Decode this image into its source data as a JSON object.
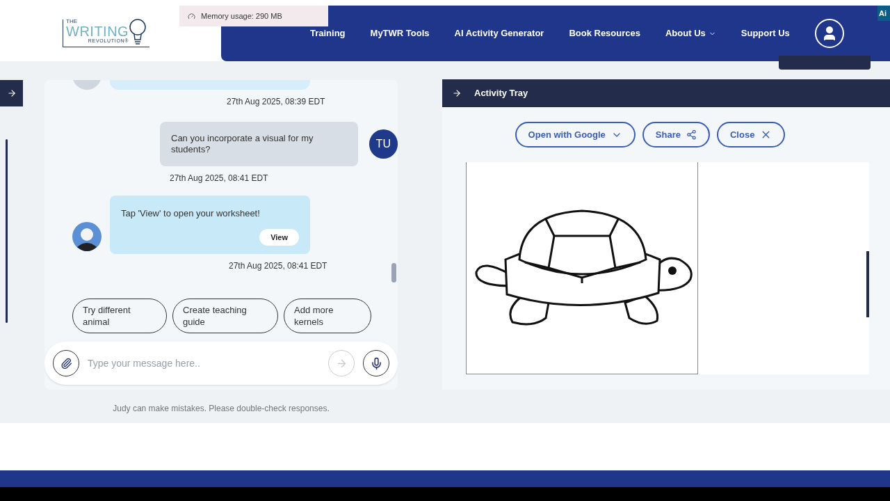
{
  "logo": {
    "top": "THE",
    "main": "WRITING",
    "bottom": "REVOLUTION®"
  },
  "memory_indicator": {
    "text": "Memory usage: 290 MB"
  },
  "nav": {
    "items": [
      {
        "label": "Training",
        "kind": "link"
      },
      {
        "label": "MyTWR Tools",
        "kind": "link"
      },
      {
        "label": "AI Activity Generator",
        "kind": "link"
      },
      {
        "label": "Book Resources",
        "kind": "link"
      },
      {
        "label": "About Us",
        "kind": "dropdown"
      },
      {
        "label": "Support Us",
        "kind": "link"
      }
    ]
  },
  "ai_badge": {
    "text": "Ai"
  },
  "chat": {
    "messages": [
      {
        "kind": "bot_partial",
        "time": "27th Aug 2025, 08:39 EDT"
      },
      {
        "kind": "user",
        "initials": "TU",
        "text": "Can you incorporate a visual for my students?",
        "time": "27th Aug 2025, 08:41 EDT"
      },
      {
        "kind": "bot",
        "text": "Tap 'View' to open your worksheet!",
        "action": "View",
        "time": "27th Aug 2025, 08:41 EDT"
      }
    ],
    "suggestions": [
      "Try different animal",
      "Create teaching guide",
      "Add more kernels"
    ],
    "input": {
      "placeholder": "Type your message here.."
    },
    "disclaimer": "Judy can make mistakes. Please double-check responses."
  },
  "activity_tray": {
    "title": "Activity Tray",
    "buttons": [
      {
        "label": "Open with Google",
        "kind": "dropdown"
      },
      {
        "label": "Share",
        "kind": "share"
      },
      {
        "label": "Close",
        "kind": "close"
      }
    ]
  }
}
